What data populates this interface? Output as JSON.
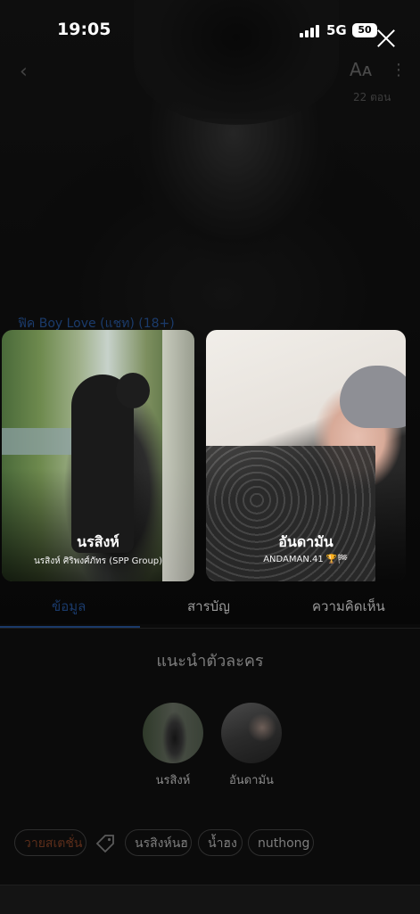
{
  "status_bar": {
    "time": "19:05",
    "network": "5G",
    "battery": "50"
  },
  "header": {
    "episodes": "22 ตอน",
    "genre": "ฟิค Boy Love (แชท) (18+)"
  },
  "characters": [
    {
      "name": "นรสิงห์",
      "subtitle": "นรสิงห์ ศิริพงศ์ภัทร (SPP Group)"
    },
    {
      "name": "อันดามัน",
      "subtitle": "ANDAMAN.41 🏆🏁"
    }
  ],
  "tabs": [
    {
      "label": "ข้อมูล",
      "active": true
    },
    {
      "label": "สารบัญ",
      "active": false
    },
    {
      "label": "ความคิดเห็น",
      "active": false
    }
  ],
  "section": {
    "title": "แนะนำตัวละคร"
  },
  "avatars": [
    {
      "label": "นรสิงห์"
    },
    {
      "label": "อันดามัน"
    }
  ],
  "tags": [
    "วายสเตชั่น",
    "นรสิงห์นฮ",
    "น้ำฮง",
    "nuthong"
  ],
  "colors": {
    "accent": "#1a3a6a",
    "background": "#0b0b0b"
  },
  "icons": [
    "back-icon",
    "font-size-icon",
    "more-icon",
    "close-icon",
    "tag-icon"
  ]
}
